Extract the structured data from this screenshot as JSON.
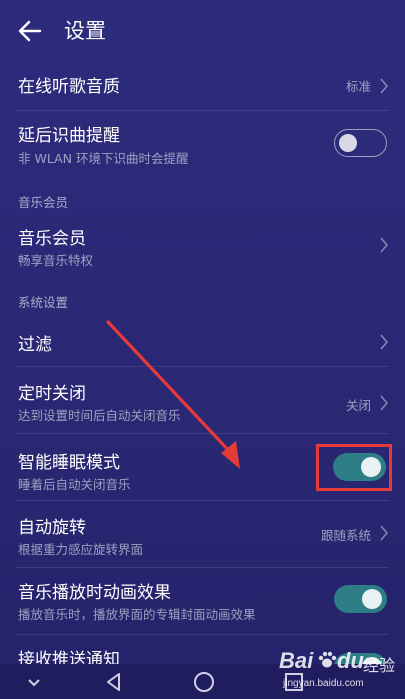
{
  "header": {
    "title": "设置"
  },
  "items": {
    "online_quality": {
      "title": "在线听歌音质",
      "value": "标准"
    },
    "post_id": {
      "title": "延后识曲提醒",
      "subtitle": "非 WLAN 环境下识曲时会提醒",
      "enabled": false
    },
    "section_music_member": "音乐会员",
    "music_member": {
      "title": "音乐会员",
      "subtitle": "畅享音乐特权"
    },
    "section_system": "系统设置",
    "filter": {
      "title": "过滤"
    },
    "timer_off": {
      "title": "定时关闭",
      "subtitle": "达到设置时间后自动关闭音乐",
      "value": "关闭"
    },
    "smart_sleep": {
      "title": "智能睡眠模式",
      "subtitle": "睡着后自动关闭音乐",
      "enabled": true
    },
    "auto_rotate": {
      "title": "自动旋转",
      "subtitle": "根据重力感应旋转界面",
      "value": "跟随系统"
    },
    "play_animation": {
      "title": "音乐播放时动画效果",
      "subtitle": "播放音乐时，播放界面的专辑封面动画效果",
      "enabled": true
    },
    "push": {
      "title": "接收推送通知",
      "enabled": true
    }
  },
  "watermark": {
    "brand": "Bai",
    "brand2": "du",
    "label": "经验",
    "url": "jingyan.baidu.com"
  },
  "colors": {
    "background": "#2b2a79",
    "toggle_on": "#2f7e86",
    "highlight": "#e53a3a"
  }
}
